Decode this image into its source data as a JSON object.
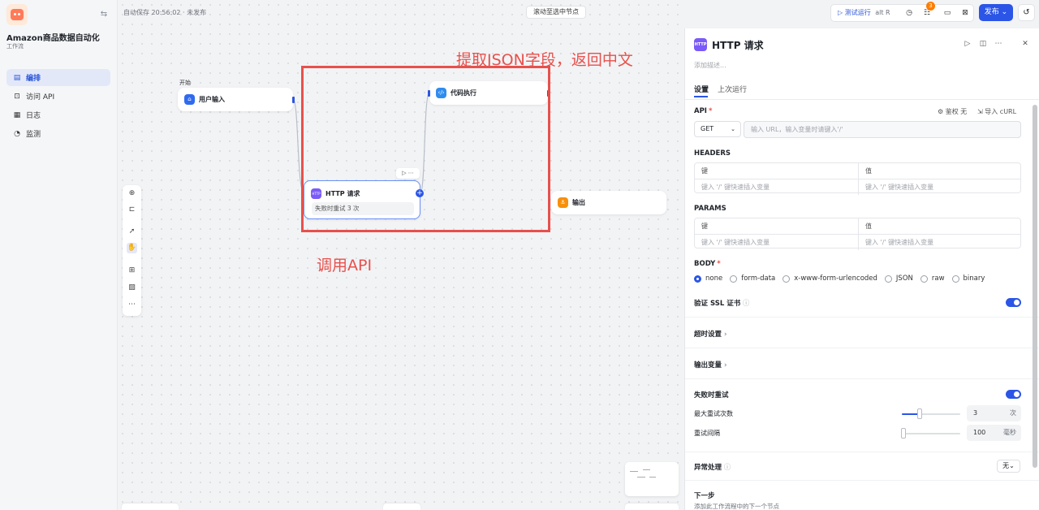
{
  "sidebar": {
    "app_title": "Amazon商品数据自动化",
    "app_subtitle": "工作流",
    "items": [
      {
        "label": "编排",
        "icon": "layout-icon"
      },
      {
        "label": "访问 API",
        "icon": "api-icon"
      },
      {
        "label": "日志",
        "icon": "log-icon"
      },
      {
        "label": "监测",
        "icon": "monitor-icon"
      }
    ]
  },
  "header": {
    "autosave": "自动保存 20:56:02 · 未发布",
    "scroll_to_node": "滚动至选中节点",
    "test_run": "测试运行",
    "test_run_shortcut": "alt R",
    "checklist_count": "3",
    "publish": "发布"
  },
  "canvas": {
    "start_label": "开始",
    "nodes": {
      "start": "用户输入",
      "code": "代码执行",
      "http": "HTTP 请求",
      "http_retry": "失败时重试 3 次",
      "output": "输出"
    },
    "annotations": {
      "json": "提取JSON字段，返回中文",
      "api": "调用API"
    }
  },
  "panel": {
    "title": "HTTP 请求",
    "icon_text": "HTTP",
    "desc_placeholder": "添加描述...",
    "tabs": [
      "设置",
      "上次运行"
    ],
    "api": {
      "label": "API",
      "auth": "鉴权 无",
      "import_curl": "导入 cURL",
      "method": "GET",
      "url_placeholder": "输入 URL，输入变量时请键入'/'"
    },
    "headers": {
      "label": "HEADERS",
      "key_header": "键",
      "value_header": "值",
      "key_placeholder": "键入 '/' 键快速插入变量",
      "value_placeholder": "键入 '/' 键快速插入变量"
    },
    "params": {
      "label": "PARAMS",
      "key_header": "键",
      "value_header": "值",
      "key_placeholder": "键入 '/' 键快速插入变量",
      "value_placeholder": "键入 '/' 键快速插入变量"
    },
    "body": {
      "label": "BODY",
      "options": [
        "none",
        "form-data",
        "x-www-form-urlencoded",
        "JSON",
        "raw",
        "binary"
      ],
      "selected": "none"
    },
    "ssl": {
      "label": "验证 SSL 证书",
      "enabled": true
    },
    "timeout": {
      "label": "超时设置"
    },
    "output_vars": {
      "label": "输出变量"
    },
    "retry": {
      "label": "失败时重试",
      "enabled": true,
      "max_label": "最大重试次数",
      "max_value": "3",
      "max_unit": "次",
      "max_fill": 0.3,
      "interval_label": "重试间隔",
      "interval_value": "100",
      "interval_unit": "毫秒",
      "interval_fill": 0.0
    },
    "exception": {
      "label": "异常处理",
      "value": "无"
    },
    "next_step": {
      "label": "下一步",
      "desc": "添加此工作流程中的下一个节点"
    }
  },
  "colors": {
    "accent": "#2b55e6",
    "annotation": "#e8504c",
    "http_icon": "#7a5af8",
    "start_icon": "#2f6bf0",
    "code_icon": "#2f8cf0",
    "output_icon": "#f79009"
  }
}
